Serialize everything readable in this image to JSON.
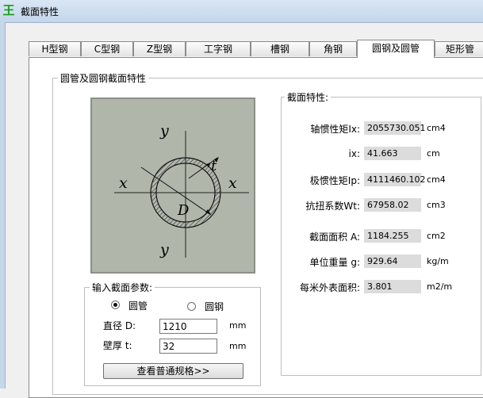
{
  "window": {
    "title": "截面特性",
    "icon": "app-logo-icon"
  },
  "tabs": [
    {
      "label": "H型钢",
      "active": false
    },
    {
      "label": "C型钢",
      "active": false
    },
    {
      "label": "Z型钢",
      "active": false
    },
    {
      "label": "工字钢",
      "active": false
    },
    {
      "label": "槽钢",
      "active": false
    },
    {
      "label": "角钢",
      "active": false
    },
    {
      "label": "圆钢及圆管",
      "active": true
    },
    {
      "label": "矩形管",
      "active": false
    }
  ],
  "group_title": "圆管及圆钢截面特性",
  "diagram": {
    "label_y_top": "y",
    "label_y_bottom": "y",
    "label_x_left": "x",
    "label_x_right": "x",
    "label_t": "t",
    "label_D": "D",
    "background_color": "#b1b6ab"
  },
  "input_group": {
    "title": "输入截面参数:",
    "type_options": [
      {
        "label": "圆管",
        "selected": true
      },
      {
        "label": "圆钢",
        "selected": false
      }
    ],
    "diameter": {
      "label": "直径 D:",
      "value": "1210",
      "unit": "mm"
    },
    "thickness": {
      "label": "壁厚 t:",
      "value": "32",
      "unit": "mm"
    },
    "button_label": "查看普通规格>>"
  },
  "properties": {
    "title": "截面特性:",
    "items": [
      {
        "label": "轴惯性矩Ix:",
        "value": "2055730.051",
        "unit": "cm4"
      },
      {
        "label": "ix:",
        "value": "41.663",
        "unit": "cm"
      },
      {
        "label": "极惯性矩Ip:",
        "value": "4111460.102",
        "unit": "cm4"
      },
      {
        "label": "抗扭系数Wt:",
        "value": "67958.02",
        "unit": "cm3"
      },
      {
        "label": "截面面积 A:",
        "value": "1184.255",
        "unit": "cm2"
      },
      {
        "label": "单位重量 g:",
        "value": "929.64",
        "unit": "kg/m"
      },
      {
        "label": "每米外表面积:",
        "value": "3.801",
        "unit": "m2/m"
      }
    ]
  }
}
